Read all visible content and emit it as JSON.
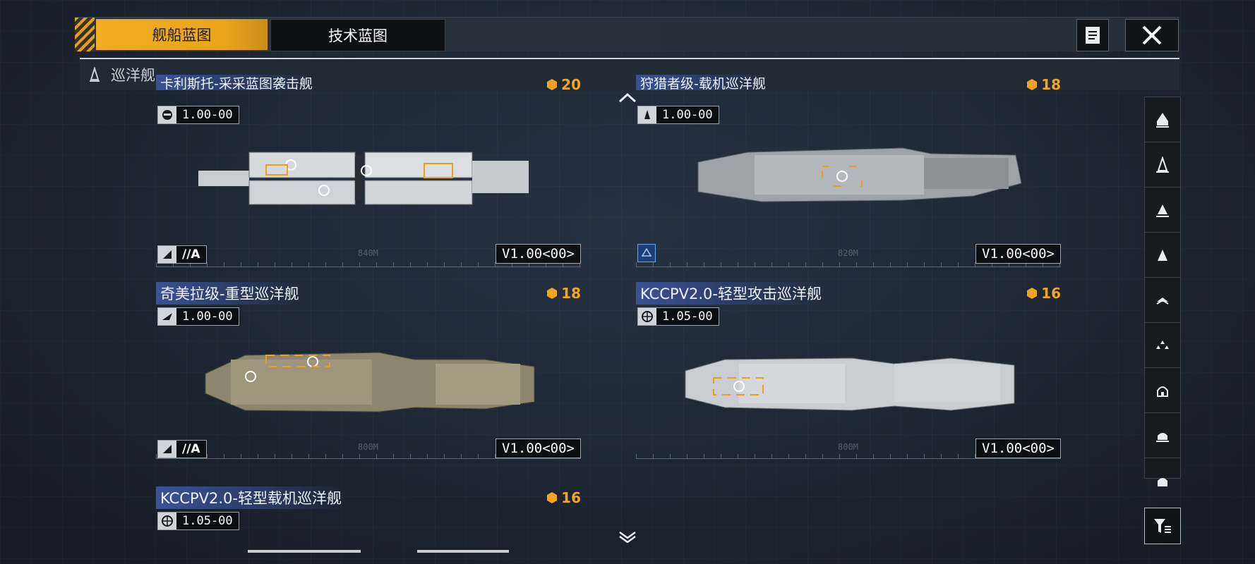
{
  "tabs": [
    {
      "label": "舰船蓝图",
      "active": true
    },
    {
      "label": "技术蓝图",
      "active": false
    }
  ],
  "toolbar": {
    "notes_icon": "document-list-icon",
    "close_icon": "close-icon"
  },
  "category": {
    "icon": "cruiser-class-icon",
    "label": "巡洋舰"
  },
  "colors": {
    "accent": "#f0ac22",
    "name_tag": "#3a5296",
    "cost": "#f0a622"
  },
  "cards": [
    {
      "name": "卡利斯托-采采蓝图袭击舰",
      "cost": "20",
      "version_small": "1.00-00",
      "version_big": "V1.00<00>",
      "tier": "//A",
      "dim": "840M",
      "origin_icon": "hammer-faction-icon"
    },
    {
      "name": "狩猎者级-载机巡洋舰",
      "cost": "18",
      "version_small": "1.00-00",
      "version_big": "V1.00<00>",
      "tier": "",
      "dim": "820M",
      "origin_icon": "ship-faction-icon"
    },
    {
      "name": "奇美拉级-重型巡洋舰",
      "cost": "18",
      "version_small": "1.00-00",
      "version_big": "V1.00<00>",
      "tier": "//A",
      "dim": "800M",
      "origin_icon": "wing-faction-icon"
    },
    {
      "name": "KCCPV2.0-轻型攻击巡洋舰",
      "cost": "16",
      "version_small": "1.05-00",
      "version_big": "V1.00<00>",
      "tier": "",
      "dim": "800M",
      "origin_icon": "globe-icon"
    },
    {
      "name": "KCCPV2.0-轻型载机巡洋舰",
      "cost": "16",
      "version_small": "1.05-00",
      "version_big": "",
      "tier": "",
      "dim": "",
      "origin_icon": "globe-icon"
    }
  ],
  "sidebar": {
    "items": [
      "carrier-class-icon",
      "cruiser-class-icon",
      "destroyer-class-icon",
      "frigate-class-icon",
      "corvette-class-icon",
      "fighter-class-icon",
      "battleship-class-icon",
      "auxiliary-class-icon",
      "support-class-icon"
    ],
    "filter_icon": "filter-icon"
  }
}
